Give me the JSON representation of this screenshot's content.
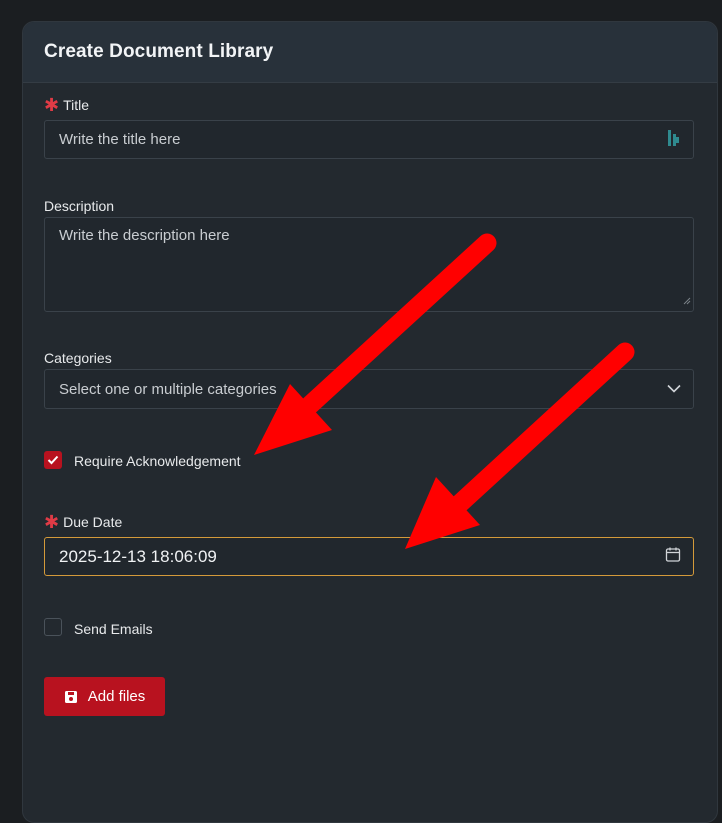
{
  "form": {
    "title": "Create Document Library",
    "title_field": {
      "label": "Title",
      "placeholder": "Write the title here"
    },
    "description_field": {
      "label": "Description",
      "placeholder": "Write the description here"
    },
    "categories_field": {
      "label": "Categories",
      "placeholder": "Select one or multiple categories"
    },
    "require_ack": {
      "label": "Require Acknowledgement",
      "checked": true
    },
    "due_date": {
      "label": "Due Date",
      "value": "2025-12-13 18:06:09"
    },
    "send_emails": {
      "label": "Send Emails",
      "checked": false
    },
    "add_files_label": "Add files"
  },
  "colors": {
    "accent": "#b8121f",
    "required": "#e03b46",
    "focus_border": "#d49a3a",
    "annotation_arrow": "#ff0000"
  },
  "icons": [
    "asterisk-icon",
    "password-manager-icon",
    "chevron-down-icon",
    "check-icon",
    "calendar-icon",
    "save-icon",
    "resize-grip-icon"
  ]
}
